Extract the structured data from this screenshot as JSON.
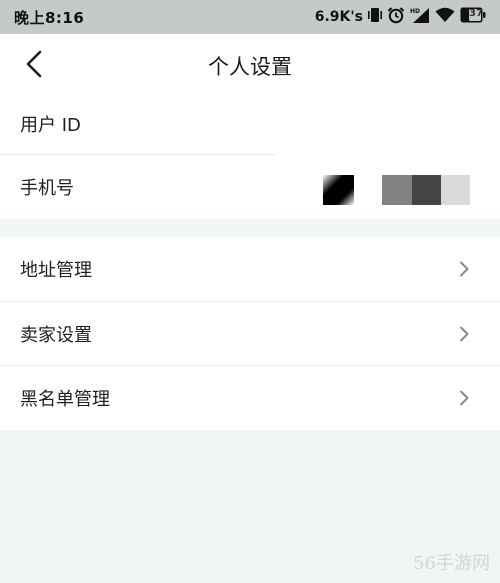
{
  "status_bar": {
    "time": "晚上8:16",
    "net_speed": "6.9K's",
    "battery": "37",
    "icons": [
      "vibrate-icon",
      "alarm-icon",
      "hd-signal-icon",
      "wifi-icon",
      "battery-icon"
    ]
  },
  "header": {
    "title": "个人设置",
    "back_icon": "chevron-left-icon"
  },
  "profile": {
    "user_id_label": "用户 ID",
    "phone_label": "手机号"
  },
  "menu": {
    "items": [
      {
        "label": "地址管理",
        "icon": "chevron-right-icon"
      },
      {
        "label": "卖家设置",
        "icon": "chevron-right-icon"
      },
      {
        "label": "黑名单管理",
        "icon": "chevron-right-icon"
      }
    ]
  },
  "watermark": "56手游网",
  "colors": {
    "status_bar_bg": "#c6c9c9",
    "page_bg": "#f1f5f5",
    "card_bg": "#ffffff",
    "chevron": "#8a8a8a"
  }
}
